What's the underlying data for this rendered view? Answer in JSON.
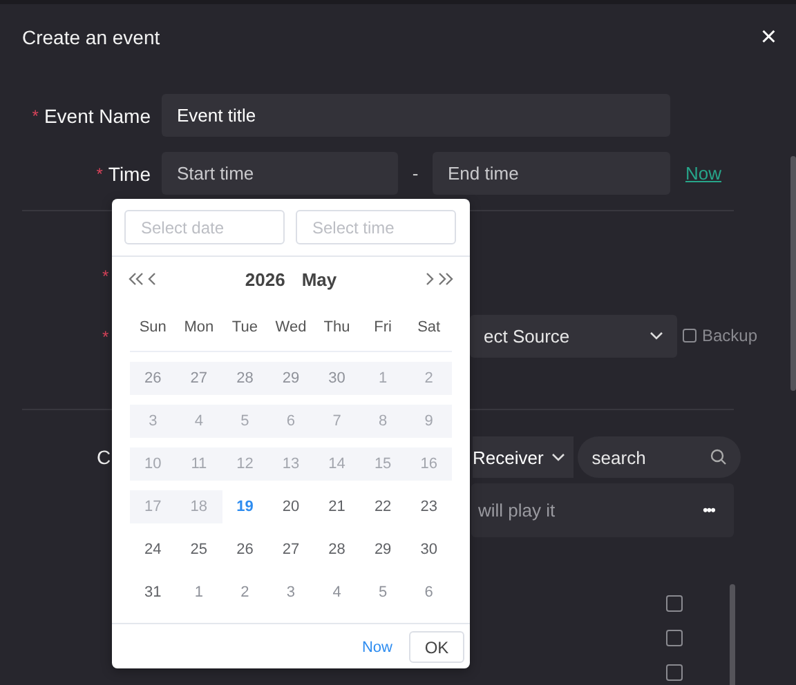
{
  "dialog": {
    "title": "Create an event",
    "close": "×"
  },
  "event_name": {
    "label": "Event Name",
    "required_mark": "*",
    "value": "Event title"
  },
  "time": {
    "label": "Time",
    "required_mark": "*",
    "start_placeholder": "Start time",
    "separator": "-",
    "end_placeholder": "End time",
    "now_link": "Now"
  },
  "source_rows": [
    {
      "required_mark": "*"
    },
    {
      "required_mark": "*",
      "select": "ect Source",
      "backup": {
        "label": "Backup",
        "checked": false
      }
    }
  ],
  "receiver_section": {
    "label": "C",
    "receiver": "Receiver",
    "search_placeholder": "search",
    "hint": "will play it",
    "more": "•••",
    "checkboxes": [
      {
        "checked": false
      },
      {
        "checked": false
      },
      {
        "checked": false
      }
    ]
  },
  "date_picker": {
    "date_placeholder": "Select date",
    "time_placeholder": "Select time",
    "year": "2026",
    "month": "May",
    "weekdays": [
      "Sun",
      "Mon",
      "Tue",
      "Wed",
      "Thu",
      "Fri",
      "Sat"
    ],
    "weeks": [
      [
        {
          "day": "26",
          "disabled": true,
          "other_month": true,
          "today": false
        },
        {
          "day": "27",
          "disabled": true,
          "other_month": true,
          "today": false
        },
        {
          "day": "28",
          "disabled": true,
          "other_month": true,
          "today": false
        },
        {
          "day": "29",
          "disabled": true,
          "other_month": true,
          "today": false
        },
        {
          "day": "30",
          "disabled": true,
          "other_month": true,
          "today": false
        },
        {
          "day": "1",
          "disabled": true,
          "other_month": false,
          "today": false
        },
        {
          "day": "2",
          "disabled": true,
          "other_month": false,
          "today": false
        }
      ],
      [
        {
          "day": "3",
          "disabled": true,
          "other_month": false,
          "today": false
        },
        {
          "day": "4",
          "disabled": true,
          "other_month": false,
          "today": false
        },
        {
          "day": "5",
          "disabled": true,
          "other_month": false,
          "today": false
        },
        {
          "day": "6",
          "disabled": true,
          "other_month": false,
          "today": false
        },
        {
          "day": "7",
          "disabled": true,
          "other_month": false,
          "today": false
        },
        {
          "day": "8",
          "disabled": true,
          "other_month": false,
          "today": false
        },
        {
          "day": "9",
          "disabled": true,
          "other_month": false,
          "today": false
        }
      ],
      [
        {
          "day": "10",
          "disabled": true,
          "other_month": false,
          "today": false
        },
        {
          "day": "11",
          "disabled": true,
          "other_month": false,
          "today": false
        },
        {
          "day": "12",
          "disabled": true,
          "other_month": false,
          "today": false
        },
        {
          "day": "13",
          "disabled": true,
          "other_month": false,
          "today": false
        },
        {
          "day": "14",
          "disabled": true,
          "other_month": false,
          "today": false
        },
        {
          "day": "15",
          "disabled": true,
          "other_month": false,
          "today": false
        },
        {
          "day": "16",
          "disabled": true,
          "other_month": false,
          "today": false
        }
      ],
      [
        {
          "day": "17",
          "disabled": true,
          "other_month": false,
          "today": false
        },
        {
          "day": "18",
          "disabled": true,
          "other_month": false,
          "today": false
        },
        {
          "day": "19",
          "disabled": false,
          "other_month": false,
          "today": true
        },
        {
          "day": "20",
          "disabled": false,
          "other_month": false,
          "today": false
        },
        {
          "day": "21",
          "disabled": false,
          "other_month": false,
          "today": false
        },
        {
          "day": "22",
          "disabled": false,
          "other_month": false,
          "today": false
        },
        {
          "day": "23",
          "disabled": false,
          "other_month": false,
          "today": false
        }
      ],
      [
        {
          "day": "24",
          "disabled": false,
          "other_month": false,
          "today": false
        },
        {
          "day": "25",
          "disabled": false,
          "other_month": false,
          "today": false
        },
        {
          "day": "26",
          "disabled": false,
          "other_month": false,
          "today": false
        },
        {
          "day": "27",
          "disabled": false,
          "other_month": false,
          "today": false
        },
        {
          "day": "28",
          "disabled": false,
          "other_month": false,
          "today": false
        },
        {
          "day": "29",
          "disabled": false,
          "other_month": false,
          "today": false
        },
        {
          "day": "30",
          "disabled": false,
          "other_month": false,
          "today": false
        }
      ],
      [
        {
          "day": "31",
          "disabled": false,
          "other_month": false,
          "today": false
        },
        {
          "day": "1",
          "disabled": false,
          "other_month": true,
          "today": false
        },
        {
          "day": "2",
          "disabled": false,
          "other_month": true,
          "today": false
        },
        {
          "day": "3",
          "disabled": false,
          "other_month": true,
          "today": false
        },
        {
          "day": "4",
          "disabled": false,
          "other_month": true,
          "today": false
        },
        {
          "day": "5",
          "disabled": false,
          "other_month": true,
          "today": false
        },
        {
          "day": "6",
          "disabled": false,
          "other_month": true,
          "today": false
        }
      ]
    ],
    "now": "Now",
    "ok": "OK"
  }
}
